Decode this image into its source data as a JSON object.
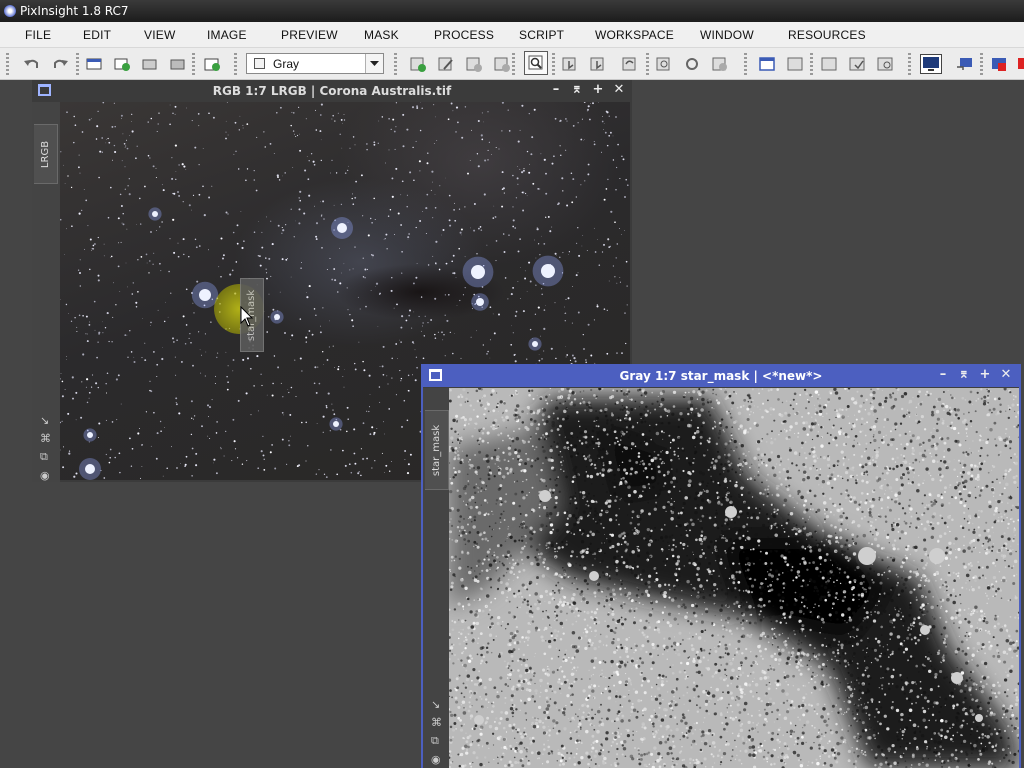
{
  "app": {
    "title": "PixInsight 1.8 RC7"
  },
  "menu": [
    "FILE",
    "EDIT",
    "VIEW",
    "IMAGE",
    "PREVIEW",
    "MASK",
    "PROCESS",
    "SCRIPT",
    "WORKSPACE",
    "WINDOW",
    "RESOURCES"
  ],
  "toolbar": {
    "color_space": "Gray"
  },
  "windows": {
    "rgb": {
      "title": "RGB 1:7 LRGB | Corona Australis.tif",
      "tab_label": "LRGB"
    },
    "mask": {
      "title": "Gray 1:7 star_mask | <*new*>",
      "tab_label": "star_mask"
    }
  },
  "drag_tab": {
    "label": "star_mask"
  },
  "colors": {
    "active_window": "#4c5fc0",
    "workspace": "#454545"
  },
  "icons": [
    "undo-icon",
    "redo-icon",
    "window-minimize-icon",
    "window-shade-icon",
    "window-maximize-icon",
    "window-close-icon",
    "chevron-down-icon",
    "zoom-icon"
  ]
}
